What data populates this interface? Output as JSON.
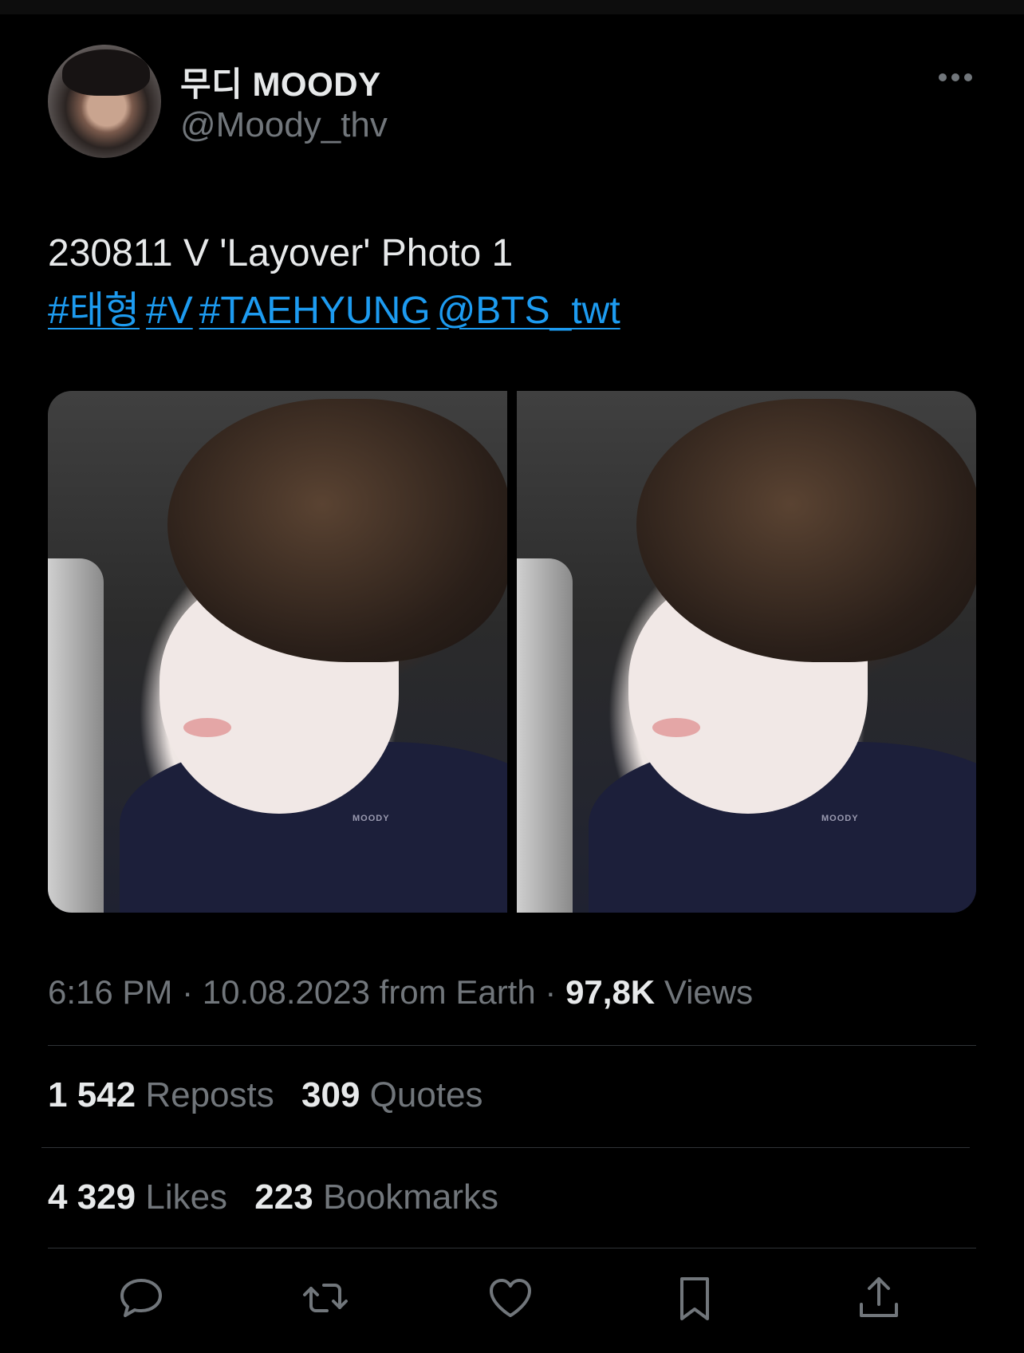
{
  "user": {
    "display_name": "무디 MOODY",
    "handle": "@Moody_thv"
  },
  "tweet": {
    "text_line1": "230811 V 'Layover' Photo 1",
    "links": [
      {
        "text": "#태형"
      },
      {
        "text": "#V"
      },
      {
        "text": "#TAEHYUNG"
      },
      {
        "text": "@BTS_twt"
      }
    ],
    "photo_watermark": "MOODY"
  },
  "meta": {
    "time": "6:16 PM",
    "date": "10.08.2023",
    "source": "from Earth",
    "separator": "·",
    "views_count": "97,8K",
    "views_label": "Views"
  },
  "stats": {
    "reposts_count": "1 542",
    "reposts_label": "Reposts",
    "quotes_count": "309",
    "quotes_label": "Quotes",
    "likes_count": "4 329",
    "likes_label": "Likes",
    "bookmarks_count": "223",
    "bookmarks_label": "Bookmarks"
  },
  "icons": {
    "more": "more-horizontal-icon",
    "reply": "reply-icon",
    "repost": "repost-icon",
    "like": "heart-icon",
    "bookmark": "bookmark-icon",
    "share": "share-icon"
  },
  "colors": {
    "background": "#000000",
    "text": "#e7e9ea",
    "muted": "#71767b",
    "link": "#1d9bf0",
    "divider": "#2f3336"
  }
}
